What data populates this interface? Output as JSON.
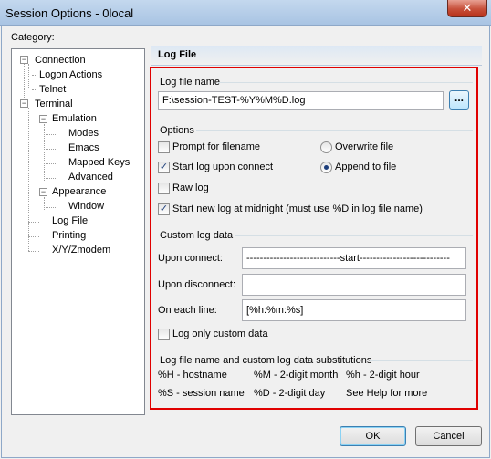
{
  "window": {
    "title": "Session Options - 0local",
    "close_glyph": "✕"
  },
  "category_label": "Category:",
  "tree": [
    {
      "label": "Connection",
      "level": 0,
      "expanded": true
    },
    {
      "label": "Logon Actions",
      "level": 1
    },
    {
      "label": "Telnet",
      "level": 1
    },
    {
      "label": "Terminal",
      "level": 0,
      "expanded": true
    },
    {
      "label": "Emulation",
      "level": 1,
      "expanded": true
    },
    {
      "label": "Modes",
      "level": 2
    },
    {
      "label": "Emacs",
      "level": 2
    },
    {
      "label": "Mapped Keys",
      "level": 2
    },
    {
      "label": "Advanced",
      "level": 2
    },
    {
      "label": "Appearance",
      "level": 1,
      "expanded": true
    },
    {
      "label": "Window",
      "level": 2
    },
    {
      "label": "Log File",
      "level": 1,
      "selected": true
    },
    {
      "label": "Printing",
      "level": 1
    },
    {
      "label": "X/Y/Zmodem",
      "level": 1
    }
  ],
  "section_title": "Log File",
  "log_file_name": {
    "group_title": "Log file name",
    "value": "F:\\session-TEST-%Y%M%D.log",
    "browse_label": "..."
  },
  "options": {
    "group_title": "Options",
    "prompt_for_filename": {
      "label": "Prompt for filename",
      "checked": false
    },
    "start_log_upon_connect": {
      "label": "Start log upon connect",
      "checked": true
    },
    "raw_log": {
      "label": "Raw log",
      "checked": false
    },
    "start_new_log_midnight": {
      "label": "Start new log at midnight (must use %D in log file name)",
      "checked": true
    },
    "overwrite_file": {
      "label": "Overwrite file",
      "selected": false
    },
    "append_to_file": {
      "label": "Append to file",
      "selected": true
    }
  },
  "custom_log_data": {
    "group_title": "Custom log data",
    "upon_connect_label": "Upon connect:",
    "upon_connect_value": "----------------------------start---------------------------",
    "upon_disconnect_label": "Upon disconnect:",
    "upon_disconnect_value": "",
    "on_each_line_label": "On each line:",
    "on_each_line_value": "[%h:%m:%s]",
    "log_only_custom": {
      "label": "Log only custom data",
      "checked": false
    }
  },
  "substitutions": {
    "group_title": "Log file name and custom log data substitutions",
    "row1": [
      "%H - hostname",
      "%M - 2-digit month",
      "%h - 2-digit hour"
    ],
    "row2": [
      "%S - session name",
      "%D - 2-digit day",
      "See Help for more"
    ]
  },
  "buttons": {
    "ok": "OK",
    "cancel": "Cancel"
  },
  "colors": {
    "highlight_border": "#e00000",
    "check_color": "#1c3d7a"
  }
}
